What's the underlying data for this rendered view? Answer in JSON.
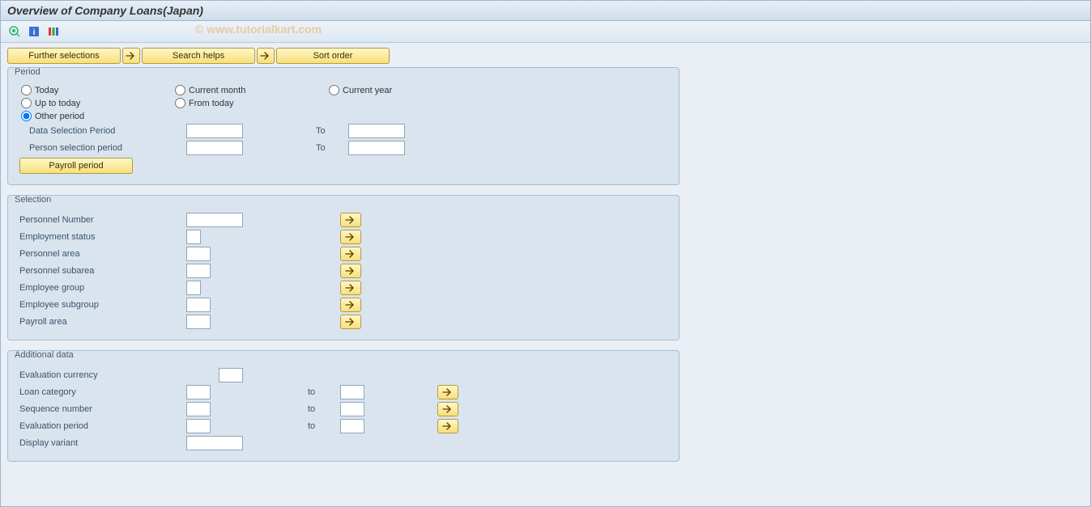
{
  "title": "Overview of Company Loans(Japan)",
  "watermark": "© www.tutorialkart.com",
  "toolbar_buttons": {
    "further_selections": "Further selections",
    "search_helps": "Search helps",
    "sort_order": "Sort order"
  },
  "period": {
    "legend": "Period",
    "radios": {
      "today": "Today",
      "current_month": "Current month",
      "current_year": "Current year",
      "up_to_today": "Up to today",
      "from_today": "From today",
      "other_period": "Other period"
    },
    "data_selection_label": "Data Selection Period",
    "person_selection_label": "Person selection period",
    "to_label": "To",
    "payroll_period_btn": "Payroll period"
  },
  "selection": {
    "legend": "Selection",
    "personnel_number": "Personnel Number",
    "employment_status": "Employment status",
    "personnel_area": "Personnel area",
    "personnel_subarea": "Personnel subarea",
    "employee_group": "Employee group",
    "employee_subgroup": "Employee subgroup",
    "payroll_area": "Payroll area"
  },
  "additional": {
    "legend": "Additional data",
    "evaluation_currency": "Evaluation currency",
    "loan_category": "Loan category",
    "sequence_number": "Sequence number",
    "evaluation_period": "Evaluation period",
    "display_variant": "Display variant",
    "to_label": "to"
  }
}
